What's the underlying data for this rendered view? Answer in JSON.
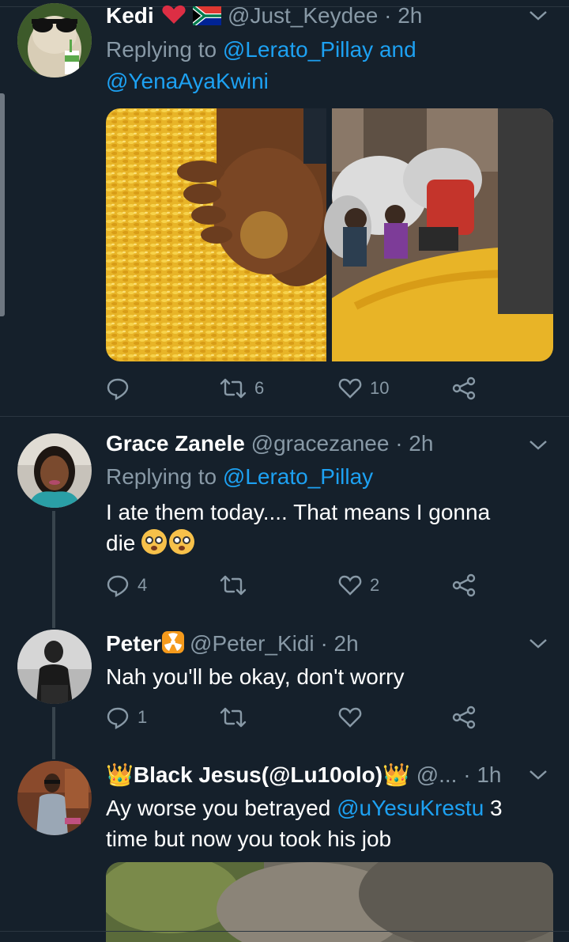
{
  "tweets": [
    {
      "name": "Kedi",
      "name_suffix": "❤🇿🇦",
      "handle": "@Just_Keydee",
      "time": "· 2h",
      "replying_prefix": "Replying to",
      "replying_to": [
        "@Lerato_Pillay",
        "@YenaAyaKwini"
      ],
      "replying_joiner": "and",
      "actions": {
        "reply": "",
        "retweet": "6",
        "like": "10"
      }
    },
    {
      "name": "Grace Zanele",
      "handle": "@gracezanee",
      "time": "· 2h",
      "replying_prefix": "Replying to",
      "replying_to": [
        "@Lerato_Pillay"
      ],
      "text_line1": "I ate them today.... That means I gonna",
      "text_line2": "die",
      "text_emoji": "😳😳",
      "actions": {
        "reply": "4",
        "retweet": "",
        "like": "2"
      }
    },
    {
      "name": "Peter",
      "name_suffix": "☢",
      "handle": "@Peter_Kidi",
      "time": "· 2h",
      "text": "Nah you'll be okay, don't worry",
      "actions": {
        "reply": "1",
        "retweet": "",
        "like": ""
      }
    },
    {
      "name": "👑Black Jesus(@Lu10olo)👑",
      "handle": "@...",
      "time": "· 1h",
      "text_pre": "Ay worse you betrayed ",
      "text_mention": "@uYesuKrestu",
      "text_post": " 3",
      "text_line2": "time but now you took his job",
      "actions": {
        "reply": "",
        "retweet": "",
        "like": ""
      }
    }
  ],
  "icons": [
    "reply-icon",
    "retweet-icon",
    "like-icon",
    "share-icon",
    "chevron-down-icon"
  ],
  "colors": {
    "background": "#15202b",
    "secondary_text": "#8899a6",
    "link": "#1da1f2",
    "divider": "#2b3640"
  }
}
